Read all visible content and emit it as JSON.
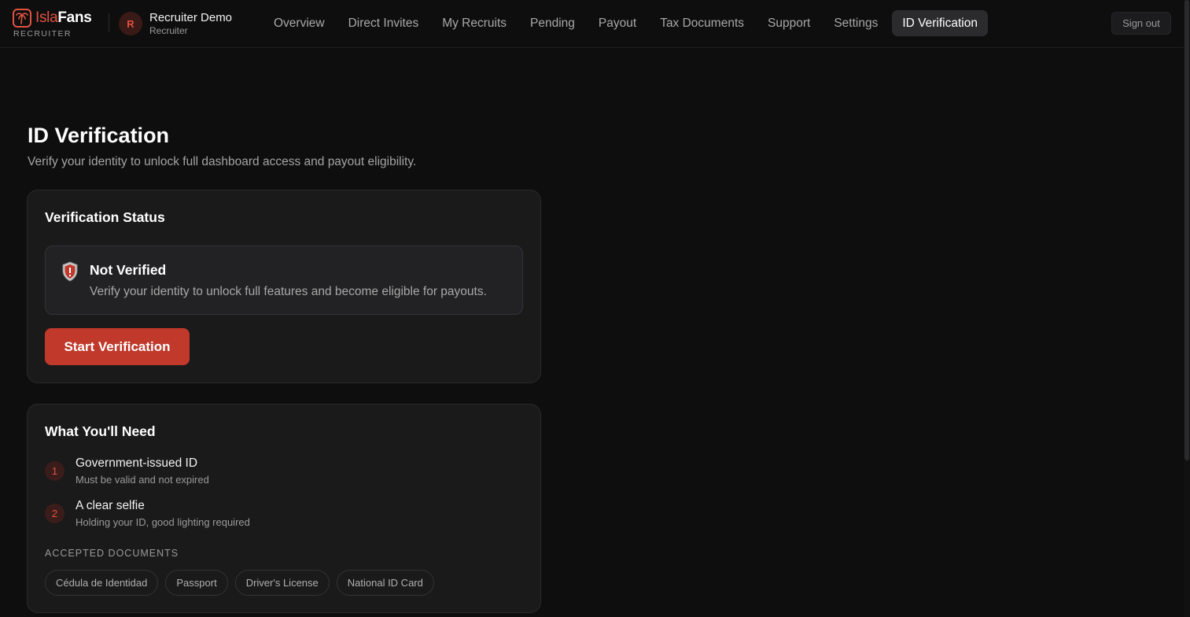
{
  "brand": {
    "name_part1": "Isla",
    "name_part2": "Fans",
    "subtitle": "RECRUITER"
  },
  "user": {
    "initial": "R",
    "name": "Recruiter Demo",
    "role": "Recruiter"
  },
  "nav": {
    "items": [
      {
        "label": "Overview"
      },
      {
        "label": "Direct Invites"
      },
      {
        "label": "My Recruits"
      },
      {
        "label": "Pending"
      },
      {
        "label": "Payout"
      },
      {
        "label": "Tax Documents"
      },
      {
        "label": "Support"
      },
      {
        "label": "Settings"
      },
      {
        "label": "ID Verification",
        "active": true
      }
    ],
    "signout_label": "Sign out"
  },
  "page": {
    "title": "ID Verification",
    "subtitle": "Verify your identity to unlock full dashboard access and payout eligibility."
  },
  "status_card": {
    "title": "Verification Status",
    "status_title": "Not Verified",
    "status_desc": "Verify your identity to unlock full features and become eligible for payouts.",
    "button_label": "Start Verification",
    "status_icon": "shield-icon"
  },
  "requirements_card": {
    "title": "What You'll Need",
    "items": [
      {
        "num": "1",
        "title": "Government-issued ID",
        "desc": "Must be valid and not expired"
      },
      {
        "num": "2",
        "title": "A clear selfie",
        "desc": "Holding your ID, good lighting required"
      }
    ],
    "accepted_label": "ACCEPTED DOCUMENTS",
    "documents": [
      "Cédula de Identidad",
      "Passport",
      "Driver's License",
      "National ID Card"
    ]
  },
  "colors": {
    "accent": "#c0392b",
    "brand_red": "#e0533f",
    "background": "#0e0e0f",
    "card": "#1a1a1b"
  }
}
